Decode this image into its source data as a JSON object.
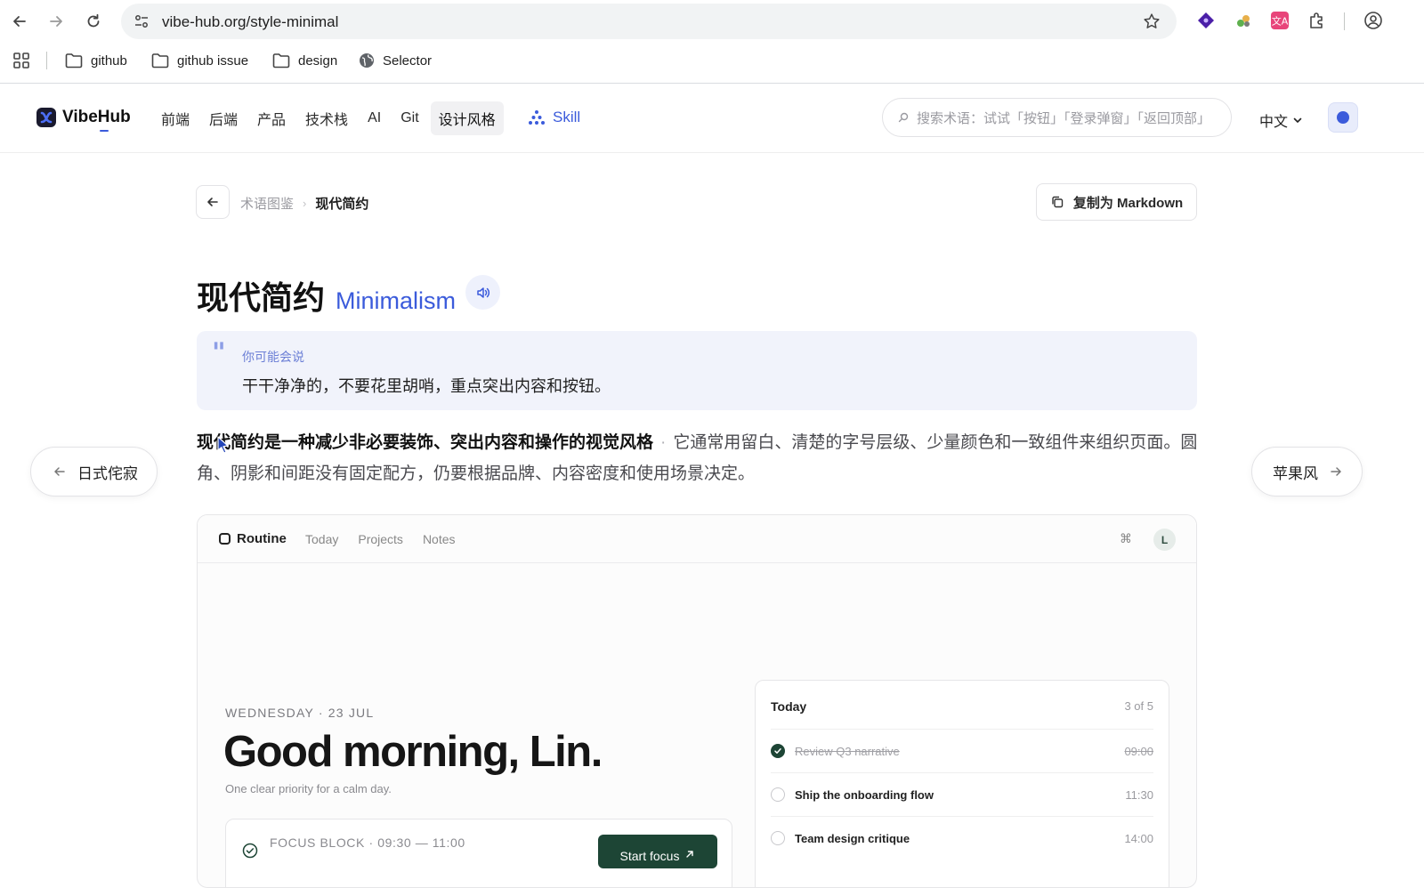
{
  "browser": {
    "url": "vibe-hub.org/style-minimal",
    "bookmarks": [
      {
        "label": "github",
        "icon": "folder-icon"
      },
      {
        "label": "github issue",
        "icon": "folder-icon"
      },
      {
        "label": "design",
        "icon": "folder-icon"
      },
      {
        "label": "Selector",
        "icon": "globe-icon"
      }
    ]
  },
  "site": {
    "logo": "VibeHub",
    "nav": [
      "前端",
      "后端",
      "产品",
      "技术栈",
      "AI",
      "Git",
      "设计风格"
    ],
    "active_nav": "设计风格",
    "skill": "Skill",
    "search_placeholder": "搜索术语：试试「按钮」「登录弹窗」「返回顶部」",
    "language": "中文",
    "accent": "#3b5bdb"
  },
  "page": {
    "breadcrumb_parent": "术语图鉴",
    "breadcrumb_current": "现代简约",
    "copy_label": "复制为 Markdown",
    "title_zh": "现代简约",
    "title_en": "Minimalism",
    "quote_label": "你可能会说",
    "quote_text": "干干净净的，不要花里胡哨，重点突出内容和按钮。",
    "desc_strong": "现代简约是一种减少非必要装饰、突出内容和操作的视觉风格",
    "desc_rest": "它通常用留白、清楚的字号层级、少量颜色和一致组件来组织页面。圆角、阴影和间距没有固定配方，仍要根据品牌、内容密度和使用场景决定。",
    "prev_label": "日式侘寂",
    "next_label": "苹果风"
  },
  "demo": {
    "brand": "Routine",
    "tabs": [
      "Today",
      "Projects",
      "Notes"
    ],
    "avatar": "L",
    "date": "WEDNESDAY · 23 JUL",
    "greeting": "Good morning, Lin.",
    "subtitle": "One clear priority for a calm day.",
    "focus_label": "FOCUS BLOCK · 09:30 — 11:00",
    "focus_button": "Start focus",
    "today_title": "Today",
    "today_count": "3 of 5",
    "tasks": [
      {
        "label": "Review Q3 narrative",
        "time": "09:00",
        "done": true
      },
      {
        "label": "Ship the onboarding flow",
        "time": "11:30",
        "done": false
      },
      {
        "label": "Team design critique",
        "time": "14:00",
        "done": false
      }
    ],
    "accent": "#1d4535"
  }
}
